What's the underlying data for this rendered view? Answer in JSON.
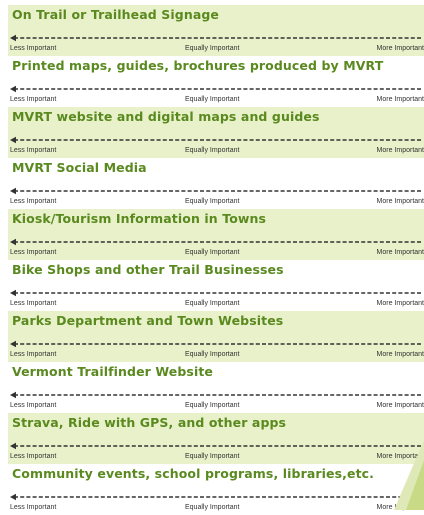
{
  "scale": {
    "less": "Less Important",
    "equal": "Equally Important",
    "more": "More Important"
  },
  "items": [
    {
      "title": "On Trail or Trailhead Signage",
      "shaded": true
    },
    {
      "title": "Printed maps, guides, brochures produced by MVRT",
      "shaded": false
    },
    {
      "title": "MVRT website and digital maps and guides",
      "shaded": true
    },
    {
      "title": "MVRT Social Media",
      "shaded": false
    },
    {
      "title": "Kiosk/Tourism Information in Towns",
      "shaded": true
    },
    {
      "title": "Bike Shops and other Trail Businesses",
      "shaded": false
    },
    {
      "title": "Parks Department and Town Websites",
      "shaded": true
    },
    {
      "title": "Vermont Trailfinder Website",
      "shaded": false
    },
    {
      "title": "Strava, Ride with GPS, and other apps",
      "shaded": true
    },
    {
      "title": "Community events, school programs, libraries,etc.",
      "shaded": false
    }
  ],
  "colors": {
    "title": "#5a8a1f",
    "shade": "#e8f1c9",
    "arrow": "#333333",
    "accent": "#b5cc6a"
  }
}
